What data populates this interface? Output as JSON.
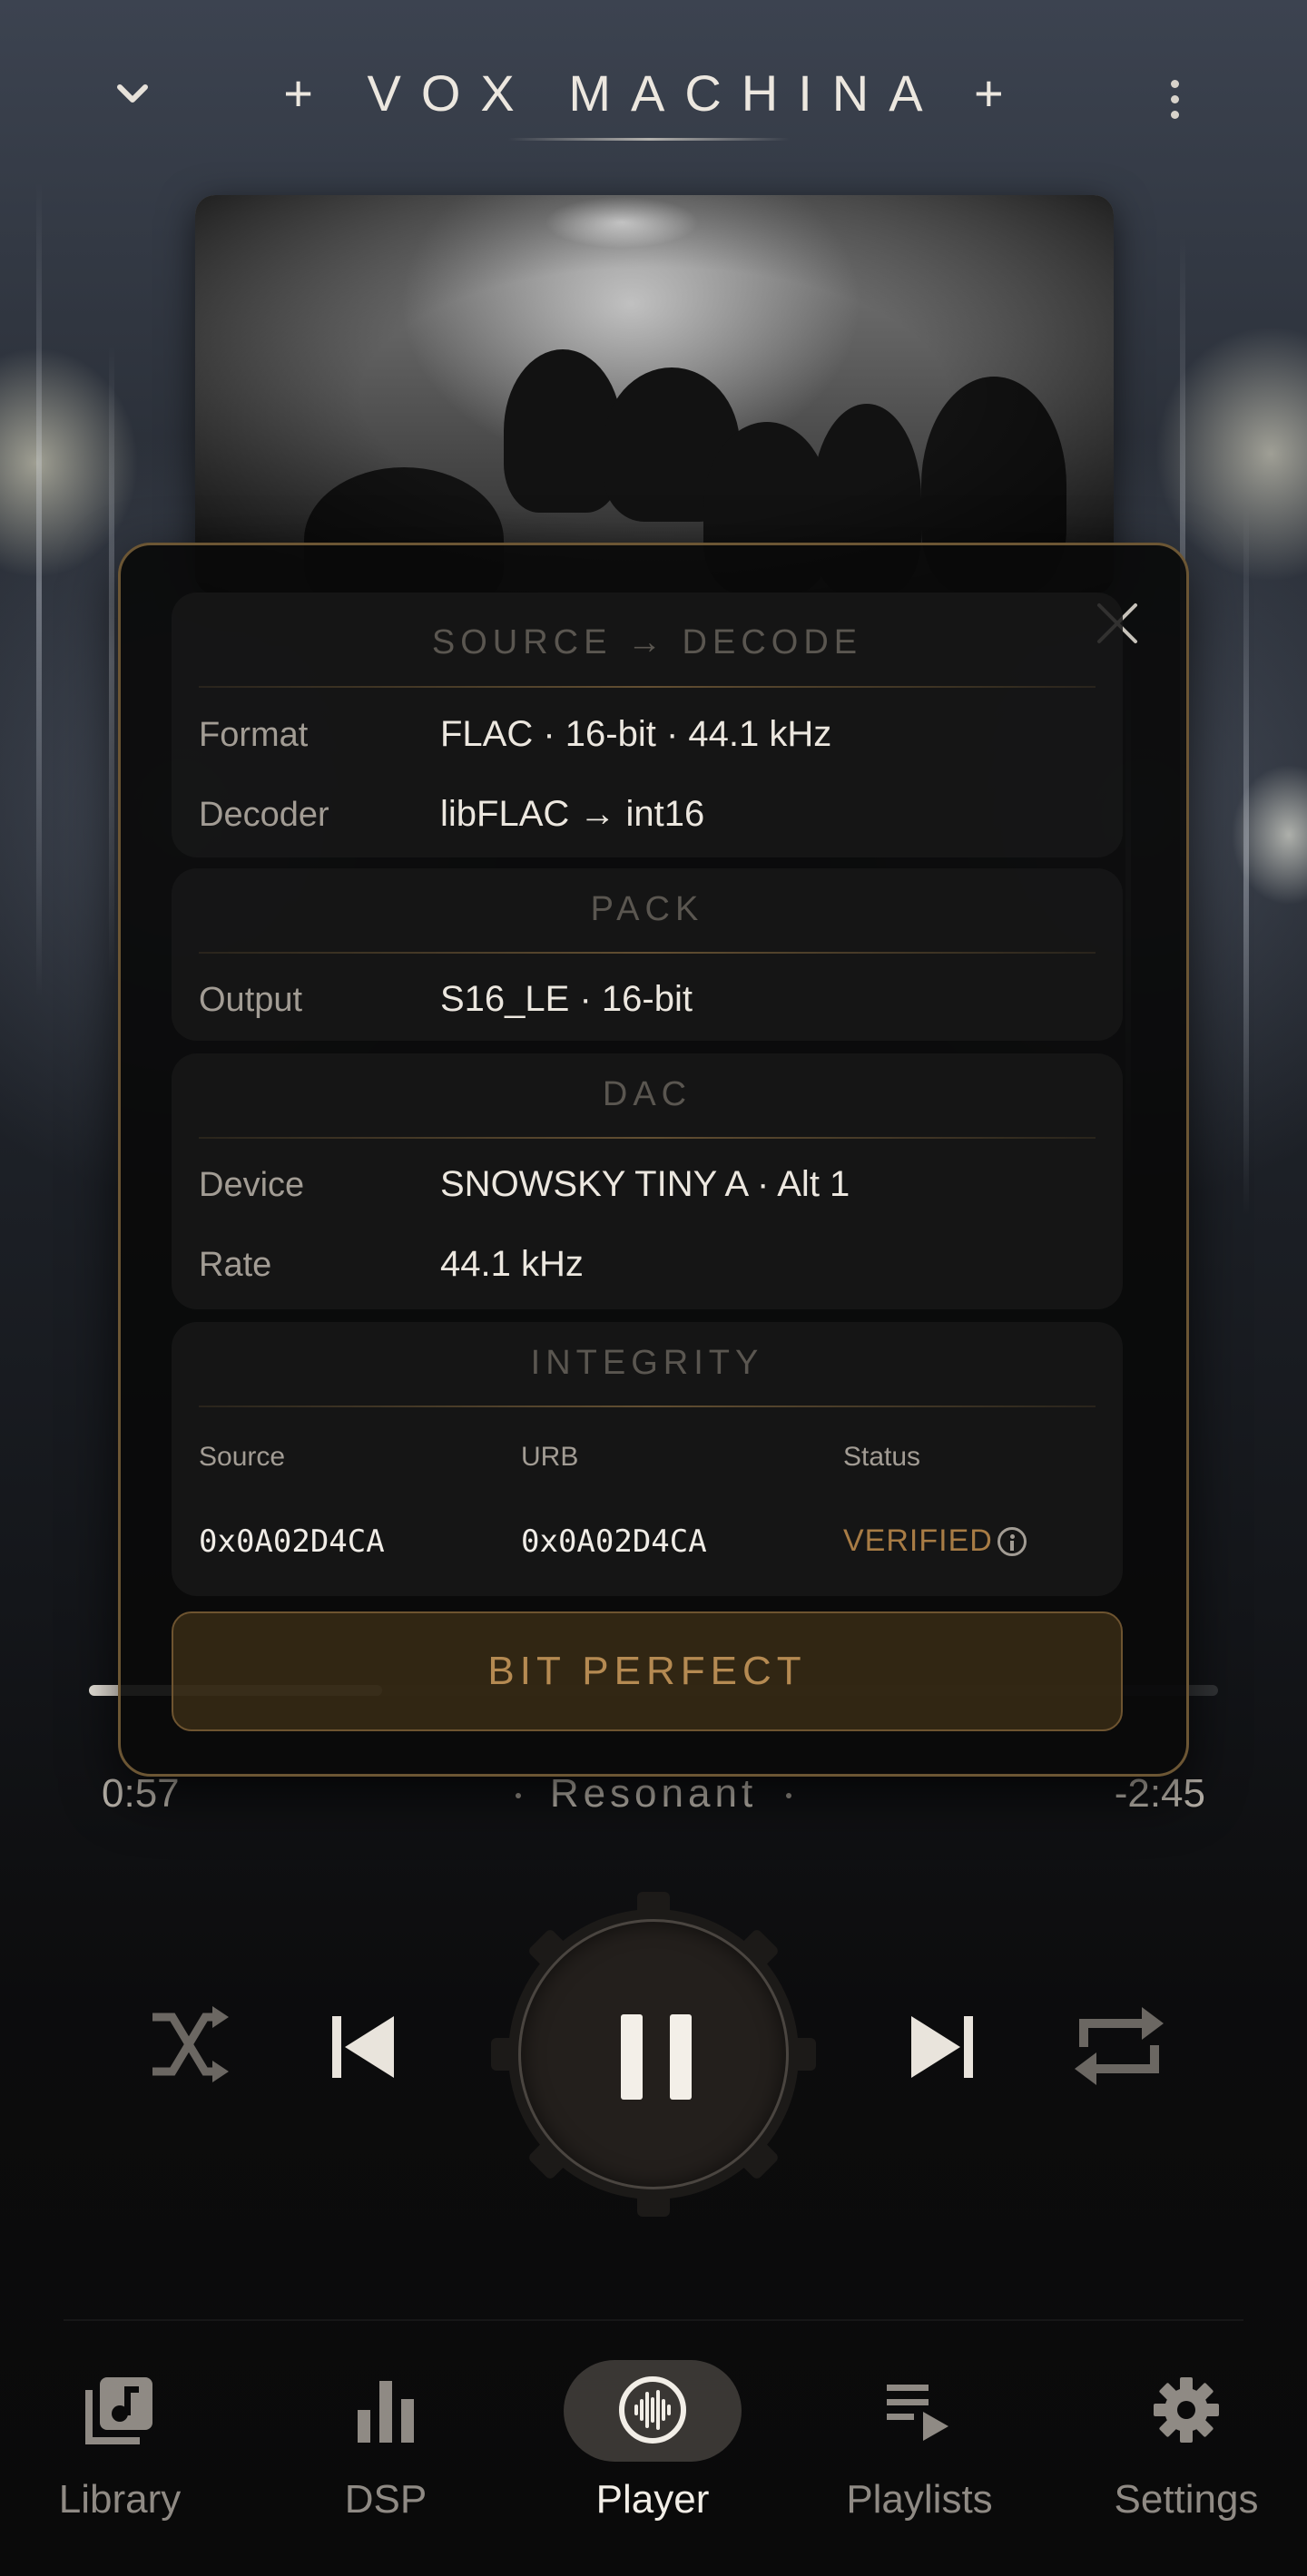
{
  "header": {
    "title": "+ VOX MACHINA +",
    "collapse_icon": "chevron-down-icon",
    "menu_icon": "more-vertical-icon"
  },
  "modal": {
    "close_icon": "close-icon",
    "source_decode": {
      "heading": "SOURCE → DECODE",
      "rows": [
        {
          "label": "Format",
          "value": "FLAC · 16-bit · 44.1 kHz"
        },
        {
          "label": "Decoder",
          "value": "libFLAC → int16"
        }
      ]
    },
    "pack": {
      "heading": "PACK",
      "rows": [
        {
          "label": "Output",
          "value": "S16_LE · 16-bit"
        }
      ]
    },
    "dac": {
      "heading": "DAC",
      "rows": [
        {
          "label": "Device",
          "value": "SNOWSKY TINY A · Alt 1"
        },
        {
          "label": "Rate",
          "value": "44.1 kHz"
        }
      ]
    },
    "integrity": {
      "heading": "INTEGRITY",
      "source_label": "Source",
      "urb_label": "URB",
      "status_label": "Status",
      "source_hash": "0x0A02D4CA",
      "urb_hash": "0x0A02D4CA",
      "status": "VERIFIED",
      "status_icon": "info-icon"
    },
    "badge": "BIT PERFECT"
  },
  "playback": {
    "elapsed": "0:57",
    "remaining": "-2:45",
    "mode": "Resonant",
    "progress": 0.26
  },
  "transport": {
    "shuffle_icon": "shuffle-icon",
    "previous_icon": "skip-previous-icon",
    "pause_icon": "pause-icon",
    "next_icon": "skip-next-icon",
    "repeat_icon": "repeat-icon"
  },
  "nav": {
    "items": [
      {
        "label": "Library",
        "icon": "library-music-icon"
      },
      {
        "label": "DSP",
        "icon": "bar-chart-icon"
      },
      {
        "label": "Player",
        "icon": "waveform-icon",
        "active": true
      },
      {
        "label": "Playlists",
        "icon": "playlist-play-icon"
      },
      {
        "label": "Settings",
        "icon": "gear-icon"
      }
    ]
  },
  "colors": {
    "accent": "#b58a52",
    "modal_border": "#6c5634",
    "text_primary": "#ece7df",
    "text_secondary": "#a29c94"
  }
}
